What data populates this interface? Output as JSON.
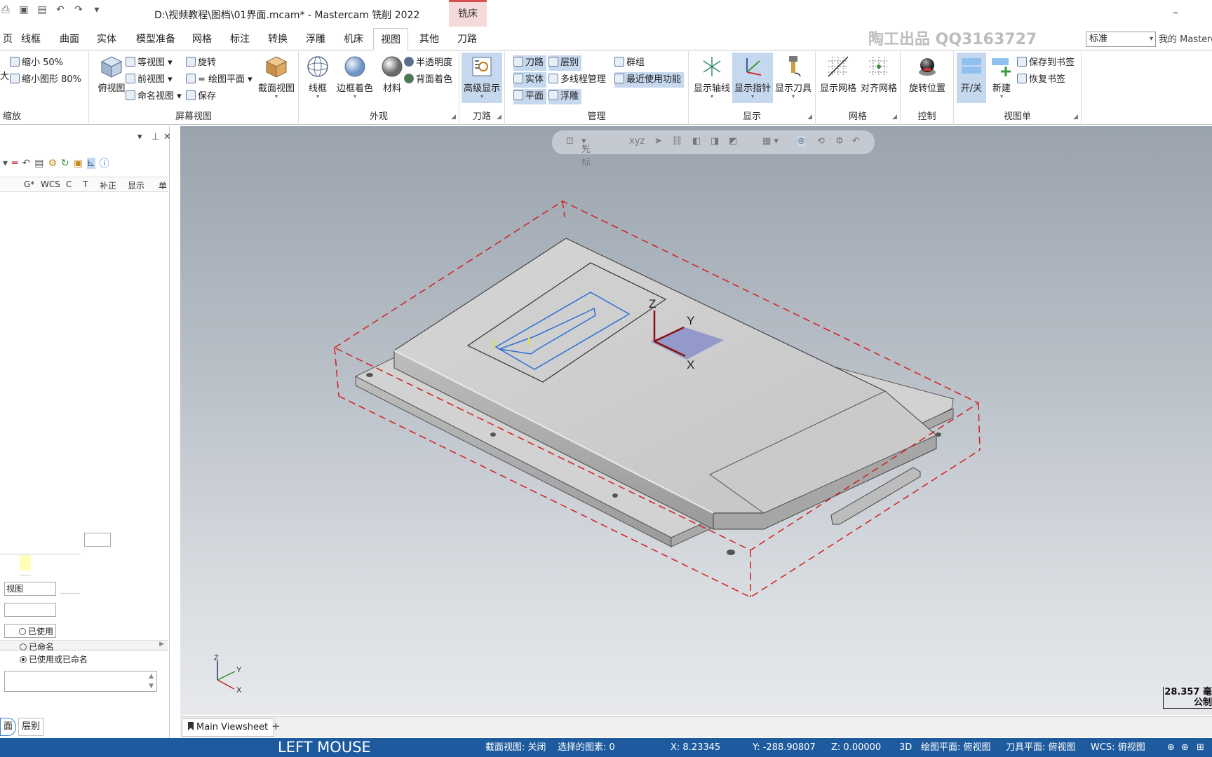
{
  "titlebar": {
    "title": "D:\\视频教程\\图档\\01界面.mcam* - Mastercam 铣削 2022",
    "context_tab": "铣床",
    "minimize": "–"
  },
  "tabs": {
    "items": [
      "页",
      "线框",
      "曲面",
      "实体",
      "模型准备",
      "网格",
      "标注",
      "转换",
      "浮雕",
      "机床",
      "视图",
      "其他",
      "刀路"
    ],
    "active": "视图",
    "watermark": "陶工出品 QQ3163727",
    "standard_select": "标准",
    "my_mastercam": "我的 Mastercam"
  },
  "ribbon": {
    "zoom": {
      "title": "缩放",
      "shrink50": "缩小 50%",
      "shrink80": "缩小图形 80%",
      "big": "大"
    },
    "screen_view": {
      "title": "屏幕视图",
      "top_view": "俯视图",
      "iso_view": "等视图",
      "front_view": "前视图",
      "named_view": "命名视图",
      "rotate": "旋转",
      "equal_plane": "= 绘图平面",
      "save": "保存",
      "section_view": "截面视图"
    },
    "appearance": {
      "title": "外观",
      "wireframe": "线框",
      "edge_shade": "边框着色",
      "material": "材料",
      "translucency": "半透明度",
      "back_shade": "背面着色"
    },
    "toolpath": {
      "title": "刀路",
      "advanced_display": "高级显示"
    },
    "manage": {
      "title": "管理",
      "toolpath": "刀路",
      "level": "层别",
      "group": "群组",
      "solid": "实体",
      "multi_thread": "多线程管理",
      "recent": "最近使用功能",
      "plane": "平面",
      "relief": "浮雕"
    },
    "display": {
      "title": "显示",
      "show_axes": "显示轴线",
      "show_gnomon": "显示指针",
      "show_tool": "显示刀具"
    },
    "grid": {
      "title": "网格",
      "show_grid": "显示网格",
      "align_grid": "对齐网格"
    },
    "control": {
      "title": "控制",
      "rotate_pos": "旋转位置"
    },
    "viewsheet": {
      "title": "视图单",
      "on_off": "开/关",
      "new": "新建",
      "save_bookmark": "保存到书签",
      "restore_bookmark": "恢复书签"
    }
  },
  "leftpanel": {
    "columns": [
      "G*",
      "WCS",
      "C",
      "T",
      "补正",
      "显示",
      "单"
    ],
    "field_name": "视图",
    "used": "已使用",
    "named": "已命名",
    "used_or_named": "已使用或已命名",
    "tabs": [
      "面",
      "层别"
    ]
  },
  "viewport": {
    "floatbar_cursor": "光标",
    "gnomon": {
      "z": "Z",
      "y": "Y",
      "x": "X"
    },
    "scale_value": "28.357 毫",
    "scale_unit": "公制"
  },
  "viewsheets": {
    "tab": "Main Viewsheet",
    "add": "+"
  },
  "statusbar": {
    "mouse": "LEFT MOUSE",
    "section": "截面视图: 关闭",
    "selected": "选择的图素: 0",
    "x": "X:   8.23345",
    "y": "Y:   -288.90807",
    "z": "Z:   0.00000",
    "mode": "3D",
    "cplane": "绘图平面: 俯视图",
    "tplane": "刀具平面: 俯视图",
    "wcs": "WCS: 俯视图"
  },
  "colors": {
    "status_bg": "#1e5a9e",
    "highlight": "#c5d8ee",
    "bbox": "#d22020",
    "toolpath": "#2a6fd6"
  }
}
